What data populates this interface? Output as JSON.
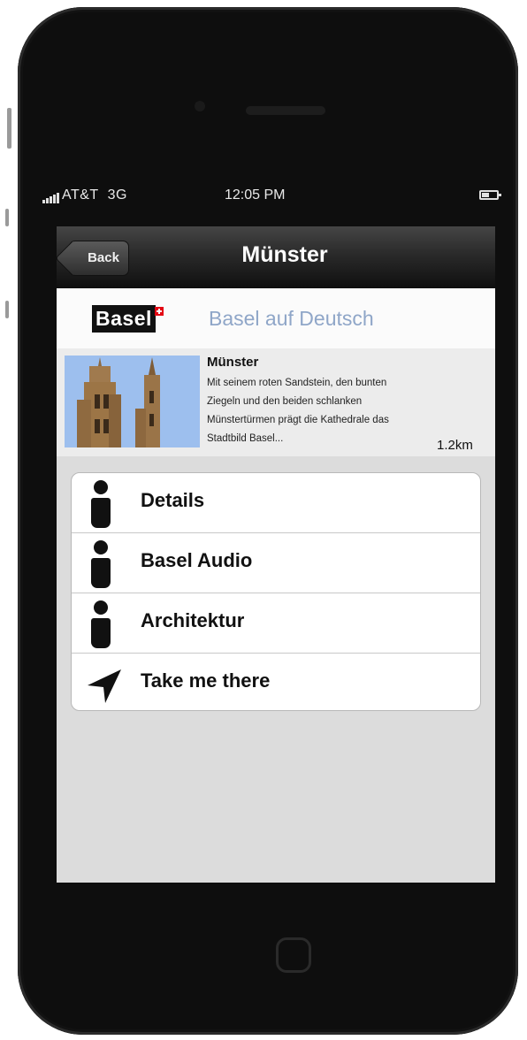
{
  "status_bar": {
    "carrier": "AT&T",
    "network": "3G",
    "time": "12:05 PM"
  },
  "nav": {
    "back_label": "Back",
    "title": "Münster"
  },
  "header": {
    "logo_text": "Basel",
    "link": "Basel auf Deutsch"
  },
  "poi": {
    "title": "Münster",
    "description": "Mit seinem roten Sandstein, den bunten Ziegeln und den beiden schlanken Münstertürmen prägt die Kathedrale das Stadtbild Basel...",
    "distance": "1.2km"
  },
  "menu": {
    "items": [
      {
        "label": "Details",
        "icon": "info-icon"
      },
      {
        "label": "Basel Audio",
        "icon": "info-icon"
      },
      {
        "label": "Architektur",
        "icon": "info-icon"
      },
      {
        "label": "Take me there",
        "icon": "location-arrow-icon"
      }
    ]
  },
  "colors": {
    "link": "#8fa6c8",
    "navbar": "#2a2a2a",
    "screen_bg": "#dcdcdc"
  }
}
